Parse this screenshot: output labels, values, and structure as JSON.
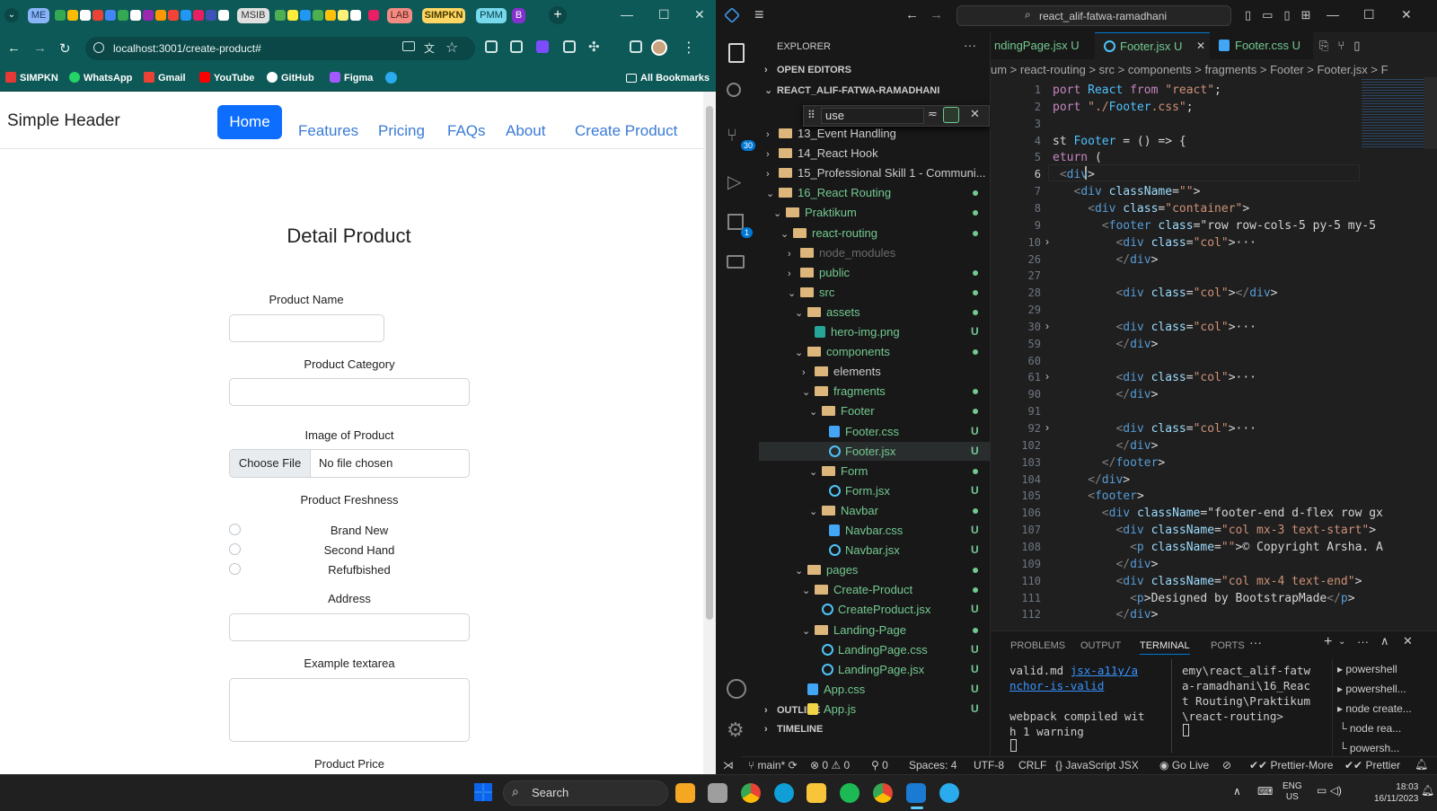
{
  "browser": {
    "tab_chips": [
      "ME",
      "MSIB",
      "LAB",
      "SIMPKN",
      "PMM",
      "B"
    ],
    "url": "localhost:3001/create-product#",
    "bookmarks": [
      "SIMPKN",
      "WhatsApp",
      "Gmail",
      "YouTube",
      "GitHub",
      "Figma"
    ],
    "all_bookmarks": "All Bookmarks"
  },
  "site": {
    "brand": "Simple Header",
    "nav": [
      "Home",
      "Features",
      "Pricing",
      "FAQs",
      "About",
      "Create Product"
    ],
    "form_title": "Detail Product",
    "labels": {
      "product_name": "Product Name",
      "product_category": "Product Category",
      "image": "Image of Product",
      "freshness": "Product Freshness",
      "address": "Address",
      "textarea": "Example textarea",
      "price": "Product Price"
    },
    "file_button": "Choose File",
    "file_status": "No file chosen",
    "freshness_options": [
      "Brand New",
      "Second Hand",
      "Refufbished"
    ]
  },
  "vscode": {
    "search_text": "react_alif-fatwa-ramadhani",
    "explorer_title": "EXPLORER",
    "open_editors": "OPEN EDITORS",
    "root": "REACT_ALIF-FATWA-RAMADHANI",
    "find_value": "use",
    "tabs": [
      "ndingPage.jsx U",
      "Footer.jsx U",
      "Footer.css U"
    ],
    "breadcrumb": "um > react-routing > src > components > fragments > Footer > Footer.jsx > F",
    "tree": [
      {
        "label": "13_Event Handling",
        "indent": 0,
        "kind": "folder",
        "open": false
      },
      {
        "label": "14_React Hook",
        "indent": 0,
        "kind": "folder",
        "open": false
      },
      {
        "label": "15_Professional Skill 1 - Communi...",
        "indent": 0,
        "kind": "folder",
        "open": false
      },
      {
        "label": "16_React Routing",
        "indent": 0,
        "kind": "folder",
        "open": true,
        "dot": true
      },
      {
        "label": "Praktikum",
        "indent": 1,
        "kind": "folder",
        "open": true,
        "dot": true
      },
      {
        "label": "react-routing",
        "indent": 2,
        "kind": "folder",
        "open": true,
        "dot": true
      },
      {
        "label": "node_modules",
        "indent": 3,
        "kind": "folder",
        "open": false,
        "dim": true
      },
      {
        "label": "public",
        "indent": 3,
        "kind": "folder",
        "open": false,
        "dot": true
      },
      {
        "label": "src",
        "indent": 3,
        "kind": "folder",
        "open": true,
        "dot": true
      },
      {
        "label": "assets",
        "indent": 4,
        "kind": "folder",
        "open": true,
        "dot": true
      },
      {
        "label": "hero-img.png",
        "indent": 5,
        "kind": "file",
        "u": true
      },
      {
        "label": "components",
        "indent": 4,
        "kind": "folder",
        "open": true,
        "dot": true
      },
      {
        "label": "elements",
        "indent": 5,
        "kind": "folder",
        "open": false
      },
      {
        "label": "fragments",
        "indent": 5,
        "kind": "folder",
        "open": true,
        "dot": true
      },
      {
        "label": "Footer",
        "indent": 6,
        "kind": "folder",
        "open": true,
        "dot": true
      },
      {
        "label": "Footer.css",
        "indent": 7,
        "kind": "css",
        "u": true
      },
      {
        "label": "Footer.jsx",
        "indent": 7,
        "kind": "react",
        "u": true,
        "selected": true
      },
      {
        "label": "Form",
        "indent": 6,
        "kind": "folder",
        "open": true,
        "dot": true
      },
      {
        "label": "Form.jsx",
        "indent": 7,
        "kind": "react",
        "u": true
      },
      {
        "label": "Navbar",
        "indent": 6,
        "kind": "folder",
        "open": true,
        "dot": true
      },
      {
        "label": "Navbar.css",
        "indent": 7,
        "kind": "css",
        "u": true
      },
      {
        "label": "Navbar.jsx",
        "indent": 7,
        "kind": "react",
        "u": true
      },
      {
        "label": "pages",
        "indent": 4,
        "kind": "folder",
        "open": true,
        "dot": true
      },
      {
        "label": "Create-Product",
        "indent": 5,
        "kind": "folder",
        "open": true,
        "dot": true
      },
      {
        "label": "CreateProduct.jsx",
        "indent": 6,
        "kind": "react",
        "u": true
      },
      {
        "label": "Landing-Page",
        "indent": 5,
        "kind": "folder",
        "open": true,
        "dot": true
      },
      {
        "label": "LandingPage.css",
        "indent": 6,
        "kind": "react",
        "u": true
      },
      {
        "label": "LandingPage.jsx",
        "indent": 6,
        "kind": "react",
        "u": true
      },
      {
        "label": "App.css",
        "indent": 4,
        "kind": "css",
        "u": true
      },
      {
        "label": "App.js",
        "indent": 4,
        "kind": "js",
        "u": true
      }
    ],
    "outline": "OUTLINE",
    "timeline": "TIMELINE",
    "code": [
      {
        "n": "1",
        "t": "port React from \"react\";"
      },
      {
        "n": "2",
        "t": "port \"./Footer.css\";"
      },
      {
        "n": "3",
        "t": ""
      },
      {
        "n": "4",
        "t": "st Footer = () => {"
      },
      {
        "n": "5",
        "t": "eturn ("
      },
      {
        "n": "6",
        "t": " <div>"
      },
      {
        "n": "7",
        "t": "   <div className=\"\">"
      },
      {
        "n": "8",
        "t": "     <div class=\"container\">"
      },
      {
        "n": "9",
        "t": "       <footer class=\"row row-cols-5 py-5 my-5"
      },
      {
        "n": "10",
        "t": "         <div class=\"col\">···"
      },
      {
        "n": "26",
        "t": "         </div>"
      },
      {
        "n": "27",
        "t": ""
      },
      {
        "n": "28",
        "t": "         <div class=\"col\"></div>"
      },
      {
        "n": "29",
        "t": ""
      },
      {
        "n": "30",
        "t": "         <div class=\"col\">···"
      },
      {
        "n": "59",
        "t": "         </div>"
      },
      {
        "n": "60",
        "t": ""
      },
      {
        "n": "61",
        "t": "         <div class=\"col\">···"
      },
      {
        "n": "90",
        "t": "         </div>"
      },
      {
        "n": "91",
        "t": ""
      },
      {
        "n": "92",
        "t": "         <div class=\"col\">···"
      },
      {
        "n": "102",
        "t": "         </div>"
      },
      {
        "n": "103",
        "t": "       </footer>"
      },
      {
        "n": "104",
        "t": "     </div>"
      },
      {
        "n": "105",
        "t": "     <footer>"
      },
      {
        "n": "106",
        "t": "       <div className=\"footer-end d-flex row gx"
      },
      {
        "n": "107",
        "t": "         <div className=\"col mx-3 text-start\">"
      },
      {
        "n": "108",
        "t": "           <p className=\"\">© Copyright Arsha. A"
      },
      {
        "n": "109",
        "t": "         </div>"
      },
      {
        "n": "110",
        "t": "         <div className=\"col mx-4 text-end\">"
      },
      {
        "n": "111",
        "t": "           <p>Designed by BootstrapMade</p>"
      },
      {
        "n": "112",
        "t": "         </div>"
      }
    ],
    "panel_tabs": [
      "PROBLEMS",
      "OUTPUT",
      "TERMINAL",
      "PORTS"
    ],
    "term_left": [
      "valid.md  jsx-a11y/a",
      "nchor-is-valid",
      "",
      "webpack compiled wit",
      "h 1 warning"
    ],
    "term_right": [
      "emy\\react_alif-fatw",
      "a-ramadhani\\16_Reac",
      "t Routing\\Praktikum",
      "\\react-routing>"
    ],
    "terminals": [
      "powershell",
      "powershell...",
      "node create...",
      "node rea...",
      "powersh..."
    ],
    "status": {
      "branch": "main*",
      "errors": "0",
      "warnings": "0",
      "ports": "0",
      "spaces": "Spaces: 4",
      "encoding": "UTF-8",
      "eol": "CRLF",
      "language": "JavaScript JSX",
      "golive": "Go Live",
      "prettier_more": "Prettier-More",
      "prettier": "Prettier"
    },
    "activity_badges": {
      "source_control": "30",
      "extensions": "1"
    }
  },
  "taskbar": {
    "search": "Search",
    "lang": "ENG",
    "region": "US",
    "time": "18:03",
    "date": "16/11/2023"
  },
  "colors": {
    "browser_teal": "#0d5957",
    "primary": "#0d6efd",
    "vscode_bg": "#1f1f1f",
    "git_green": "#73c991"
  }
}
